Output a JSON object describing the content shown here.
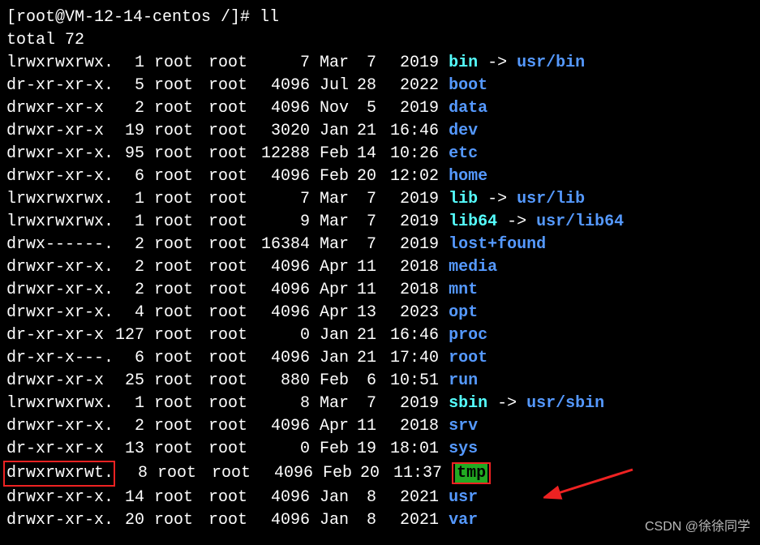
{
  "prompt": "[root@VM-12-14-centos /]# ll",
  "total": "total 72",
  "entries": [
    {
      "perms": "lrwxrwxrwx.",
      "links": "1",
      "owner": "root",
      "group": "root",
      "size": "7",
      "month": "Mar",
      "day": "7",
      "time": "2019",
      "name": "bin",
      "linkto": "usr/bin",
      "type": "link"
    },
    {
      "perms": "dr-xr-xr-x.",
      "links": "5",
      "owner": "root",
      "group": "root",
      "size": "4096",
      "month": "Jul",
      "day": "28",
      "time": "2022",
      "name": "boot",
      "type": "dir"
    },
    {
      "perms": "drwxr-xr-x",
      "links": "2",
      "owner": "root",
      "group": "root",
      "size": "4096",
      "month": "Nov",
      "day": "5",
      "time": "2019",
      "name": "data",
      "type": "dir"
    },
    {
      "perms": "drwxr-xr-x",
      "links": "19",
      "owner": "root",
      "group": "root",
      "size": "3020",
      "month": "Jan",
      "day": "21",
      "time": "16:46",
      "name": "dev",
      "type": "dir"
    },
    {
      "perms": "drwxr-xr-x.",
      "links": "95",
      "owner": "root",
      "group": "root",
      "size": "12288",
      "month": "Feb",
      "day": "14",
      "time": "10:26",
      "name": "etc",
      "type": "dir"
    },
    {
      "perms": "drwxr-xr-x.",
      "links": "6",
      "owner": "root",
      "group": "root",
      "size": "4096",
      "month": "Feb",
      "day": "20",
      "time": "12:02",
      "name": "home",
      "type": "dir"
    },
    {
      "perms": "lrwxrwxrwx.",
      "links": "1",
      "owner": "root",
      "group": "root",
      "size": "7",
      "month": "Mar",
      "day": "7",
      "time": "2019",
      "name": "lib",
      "linkto": "usr/lib",
      "type": "link"
    },
    {
      "perms": "lrwxrwxrwx.",
      "links": "1",
      "owner": "root",
      "group": "root",
      "size": "9",
      "month": "Mar",
      "day": "7",
      "time": "2019",
      "name": "lib64",
      "linkto": "usr/lib64",
      "type": "link"
    },
    {
      "perms": "drwx------.",
      "links": "2",
      "owner": "root",
      "group": "root",
      "size": "16384",
      "month": "Mar",
      "day": "7",
      "time": "2019",
      "name": "lost+found",
      "type": "dir"
    },
    {
      "perms": "drwxr-xr-x.",
      "links": "2",
      "owner": "root",
      "group": "root",
      "size": "4096",
      "month": "Apr",
      "day": "11",
      "time": "2018",
      "name": "media",
      "type": "dir"
    },
    {
      "perms": "drwxr-xr-x.",
      "links": "2",
      "owner": "root",
      "group": "root",
      "size": "4096",
      "month": "Apr",
      "day": "11",
      "time": "2018",
      "name": "mnt",
      "type": "dir"
    },
    {
      "perms": "drwxr-xr-x.",
      "links": "4",
      "owner": "root",
      "group": "root",
      "size": "4096",
      "month": "Apr",
      "day": "13",
      "time": "2023",
      "name": "opt",
      "type": "dir"
    },
    {
      "perms": "dr-xr-xr-x",
      "links": "127",
      "owner": "root",
      "group": "root",
      "size": "0",
      "month": "Jan",
      "day": "21",
      "time": "16:46",
      "name": "proc",
      "type": "dir"
    },
    {
      "perms": "dr-xr-x---.",
      "links": "6",
      "owner": "root",
      "group": "root",
      "size": "4096",
      "month": "Jan",
      "day": "21",
      "time": "17:40",
      "name": "root",
      "type": "dir"
    },
    {
      "perms": "drwxr-xr-x",
      "links": "25",
      "owner": "root",
      "group": "root",
      "size": "880",
      "month": "Feb",
      "day": "6",
      "time": "10:51",
      "name": "run",
      "type": "dir"
    },
    {
      "perms": "lrwxrwxrwx.",
      "links": "1",
      "owner": "root",
      "group": "root",
      "size": "8",
      "month": "Mar",
      "day": "7",
      "time": "2019",
      "name": "sbin",
      "linkto": "usr/sbin",
      "type": "link"
    },
    {
      "perms": "drwxr-xr-x.",
      "links": "2",
      "owner": "root",
      "group": "root",
      "size": "4096",
      "month": "Apr",
      "day": "11",
      "time": "2018",
      "name": "srv",
      "type": "dir"
    },
    {
      "perms": "dr-xr-xr-x",
      "links": "13",
      "owner": "root",
      "group": "root",
      "size": "0",
      "month": "Feb",
      "day": "19",
      "time": "18:01",
      "name": "sys",
      "type": "dir"
    },
    {
      "perms": "drwxrwxrwt.",
      "links": "8",
      "owner": "root",
      "group": "root",
      "size": "4096",
      "month": "Feb",
      "day": "20",
      "time": "11:37",
      "name": "tmp",
      "type": "sticky",
      "highlight": true
    },
    {
      "perms": "drwxr-xr-x.",
      "links": "14",
      "owner": "root",
      "group": "root",
      "size": "4096",
      "month": "Jan",
      "day": "8",
      "time": "2021",
      "name": "usr",
      "type": "dir"
    },
    {
      "perms": "drwxr-xr-x.",
      "links": "20",
      "owner": "root",
      "group": "root",
      "size": "4096",
      "month": "Jan",
      "day": "8",
      "time": "2021",
      "name": "var",
      "type": "dir"
    }
  ],
  "watermark": "CSDN @徐徐同学"
}
